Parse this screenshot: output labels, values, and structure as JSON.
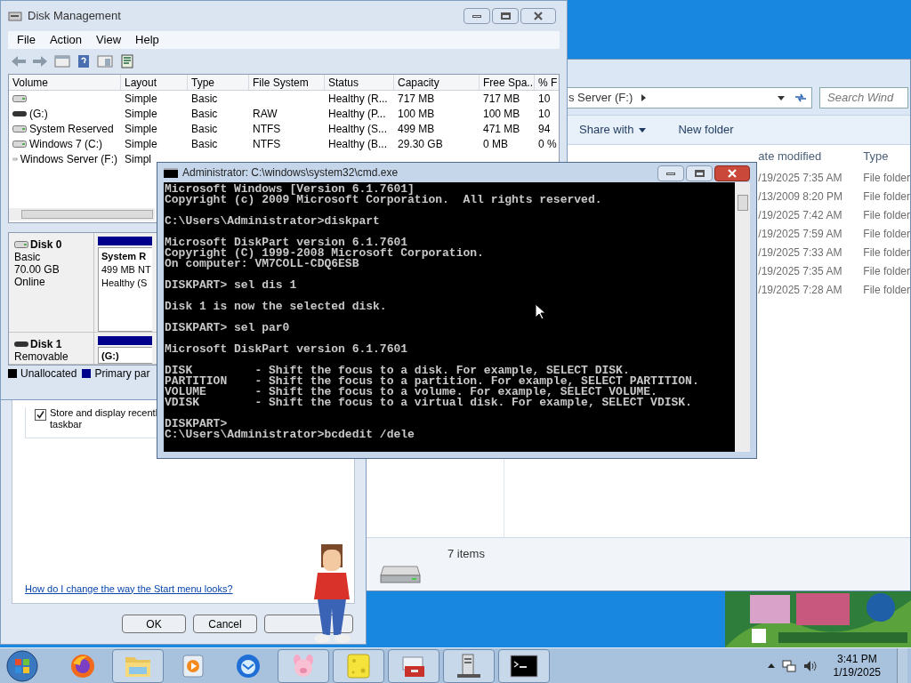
{
  "explorer": {
    "address": "s Server (F:)",
    "search": {
      "placeholder": "Search Wind"
    },
    "toolbar": [
      "Share with",
      "New folder"
    ],
    "columns": [
      "ate modified",
      "Type"
    ],
    "rows": [
      {
        "date": "/19/2025 7:35 AM",
        "type": "File folder"
      },
      {
        "date": "/13/2009 8:20 PM",
        "type": "File folder"
      },
      {
        "date": "/19/2025 7:42 AM",
        "type": "File folder"
      },
      {
        "date": "/19/2025 7:59 AM",
        "type": "File folder"
      },
      {
        "date": "/19/2025 7:33 AM",
        "type": "File folder"
      },
      {
        "date": "/19/2025 7:35 AM",
        "type": "File folder"
      },
      {
        "date": "/19/2025 7:28 AM",
        "type": "File folder"
      }
    ],
    "status": "7 items"
  },
  "start_menu_dialog": {
    "checkbox": {
      "lines": [
        "Store and display recentl",
        "taskbar"
      ],
      "checked": true
    },
    "link": "How do I change the way the Start menu looks?",
    "buttons": [
      "OK",
      "Cancel"
    ]
  },
  "disk_management": {
    "title": "Disk Management",
    "menu": [
      "File",
      "Action",
      "View",
      "Help"
    ],
    "columns": [
      "Volume",
      "Layout",
      "Type",
      "File System",
      "Status",
      "Capacity",
      "Free Spa...",
      "% F"
    ],
    "rows": [
      {
        "kind": "fixed",
        "layout": "Simple",
        "type": "Basic",
        "status": "Healthy (R...",
        "capacity": "717 MB",
        "free": "717 MB",
        "percent": "10"
      },
      {
        "kind": "removable",
        "volume": "(G:)",
        "layout": "Simple",
        "type": "Basic",
        "fs": "RAW",
        "status": "Healthy (P...",
        "capacity": "100 MB",
        "free": "100 MB",
        "percent": "10"
      },
      {
        "kind": "fixed",
        "volume": "System Reserved",
        "layout": "Simple",
        "type": "Basic",
        "fs": "NTFS",
        "status": "Healthy (S...",
        "capacity": "499 MB",
        "free": "471 MB",
        "percent": "94"
      },
      {
        "kind": "fixed",
        "volume": "Windows 7 (C:)",
        "layout": "Simple",
        "type": "Basic",
        "fs": "NTFS",
        "status": "Healthy (B...",
        "capacity": "29.30 GB",
        "free": "0 MB",
        "percent": "0 %"
      },
      {
        "kind": "fixed",
        "volume": "Windows Server (F:)",
        "layout": "Simpl"
      }
    ],
    "disks": [
      {
        "kind": "fixed",
        "name": "Disk 0",
        "info": [
          "Basic",
          "70.00 GB",
          "Online"
        ],
        "partition": {
          "name": "System R",
          "lines": [
            "499 MB NT",
            "Healthy (S"
          ]
        }
      },
      {
        "kind": "removable",
        "name": "Disk 1",
        "info": [
          "Removable"
        ],
        "partition": {
          "name": "(G:)"
        }
      }
    ],
    "legend": [
      {
        "label": "Unallocated",
        "color": "#000000"
      },
      {
        "label": "Primary par",
        "color": "#00008b"
      }
    ]
  },
  "cmd": {
    "title": "Administrator: C:\\windows\\system32\\cmd.exe",
    "blocks": [
      [
        "Microsoft Windows [Version 6.1.7601]",
        "Copyright (c) 2009 Microsoft Corporation.  All rights reserved."
      ],
      [
        "C:\\Users\\Administrator>diskpart"
      ],
      [
        "Microsoft DiskPart version 6.1.7601",
        "Copyright (C) 1999-2008 Microsoft Corporation.",
        "On computer: VM7COLL-CDQ6ESB"
      ],
      [
        "DISKPART> sel dis 1"
      ],
      [
        "Disk 1 is now the selected disk."
      ],
      [
        "DISKPART> sel par0"
      ],
      [
        "Microsoft DiskPart version 6.1.7601"
      ],
      [
        "DISK         - Shift the focus to a disk. For example, SELECT DISK.",
        "PARTITION    - Shift the focus to a partition. For example, SELECT PARTITION.",
        "VOLUME       - Shift the focus to a volume. For example, SELECT VOLUME.",
        "VDISK        - Shift the focus to a virtual disk. For example, SELECT VDISK."
      ],
      [
        "DISKPART>",
        "C:\\Users\\Administrator>bcdedit /dele"
      ]
    ]
  },
  "taskbar": {
    "items": [
      {
        "kind": "firefox",
        "open": false
      },
      {
        "kind": "folder",
        "open": true
      },
      {
        "kind": "media",
        "open": false
      },
      {
        "kind": "mail",
        "open": false
      },
      {
        "kind": "pig",
        "open": true
      },
      {
        "kind": "sponge",
        "open": true
      },
      {
        "kind": "toolbox",
        "open": true
      },
      {
        "kind": "server",
        "open": true
      },
      {
        "kind": "console",
        "open": true
      }
    ],
    "time": "3:41 PM",
    "date": "1/19/2025"
  }
}
